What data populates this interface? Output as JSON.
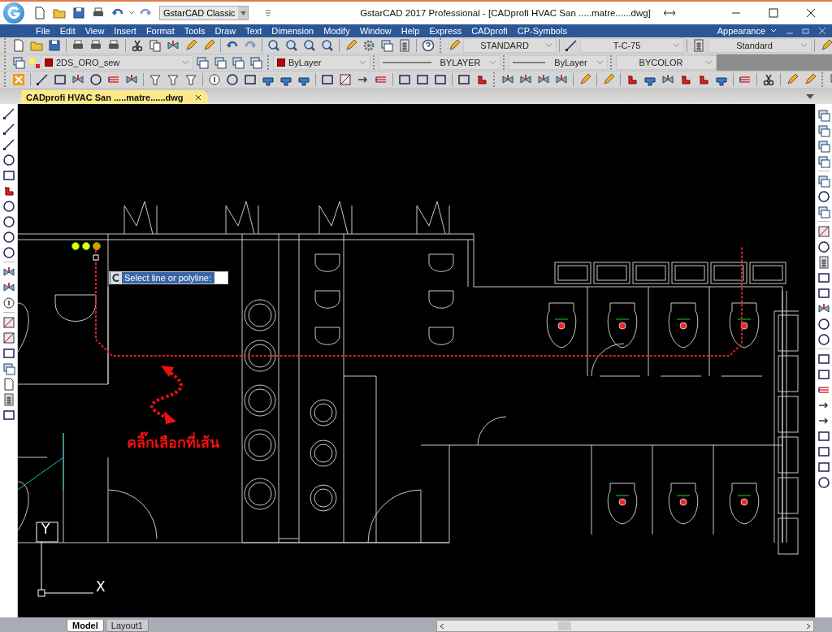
{
  "window": {
    "title": "GstarCAD 2017 Professional - [CADprofi HVAC San .....matre......dwg]"
  },
  "workspace": {
    "value": "GstarCAD Classic"
  },
  "menu": [
    "File",
    "Edit",
    "View",
    "Insert",
    "Format",
    "Tools",
    "Draw",
    "Text",
    "Dimension",
    "Modify",
    "Window",
    "Help",
    "Express",
    "CADprofi",
    "CP-Symbols"
  ],
  "appearance": {
    "label": "Appearance"
  },
  "style_toolbar": [
    {
      "value": "STANDARD"
    },
    {
      "value": "T-C-75"
    },
    {
      "value": "Standard"
    }
  ],
  "layer_toolbar": {
    "layer": "2DS_ORO_sew",
    "color_setting": "ByLayer",
    "linetype": "BYLAYER",
    "lineweight": "ByLayer",
    "plot_style": "BYCOLOR"
  },
  "document_tabs": [
    {
      "label": "CADprofi HVAC San .....matre......dwg",
      "selected": true
    }
  ],
  "command_prompt": {
    "text": "Select line or polyline:"
  },
  "annotation": {
    "text": "คลิ๊กเลือกที่เส้น"
  },
  "ucs": {
    "y_label": "Y",
    "x_label": "X"
  },
  "layout_tabs": [
    {
      "label": "Model",
      "selected": true
    },
    {
      "label": "Layout1",
      "selected": false
    }
  ]
}
